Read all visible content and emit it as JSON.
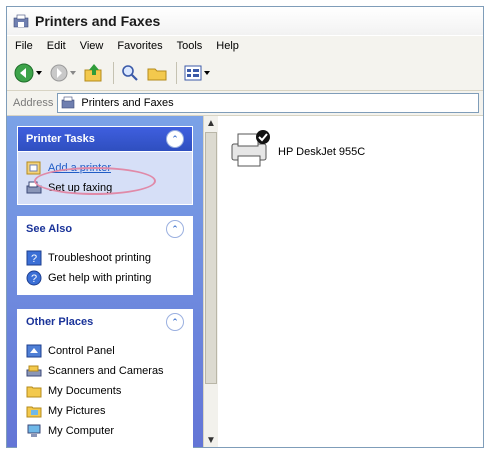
{
  "window": {
    "title": "Printers and Faxes"
  },
  "menu": [
    "File",
    "Edit",
    "View",
    "Favorites",
    "Tools",
    "Help"
  ],
  "toolbar": [
    "back-icon",
    "forward-icon",
    "up-folder-icon",
    "search-icon",
    "folders-icon",
    "views-icon"
  ],
  "address": {
    "label": "Address",
    "value": "Printers and Faxes"
  },
  "panels": {
    "printer_tasks": {
      "title": "Printer Tasks",
      "items": [
        "Add a printer",
        "Set up faxing"
      ]
    },
    "see_also": {
      "title": "See Also",
      "items": [
        "Troubleshoot printing",
        "Get help with printing"
      ]
    },
    "other_places": {
      "title": "Other Places",
      "items": [
        "Control Panel",
        "Scanners and Cameras",
        "My Documents",
        "My Pictures",
        "My Computer"
      ]
    }
  },
  "printers": [
    {
      "name": "HP DeskJet 955C"
    }
  ],
  "colors": {
    "highlight_oval": "#e08aa8",
    "task_pane": "#6375d6",
    "panel_header_dark": "#3f5fdf"
  }
}
